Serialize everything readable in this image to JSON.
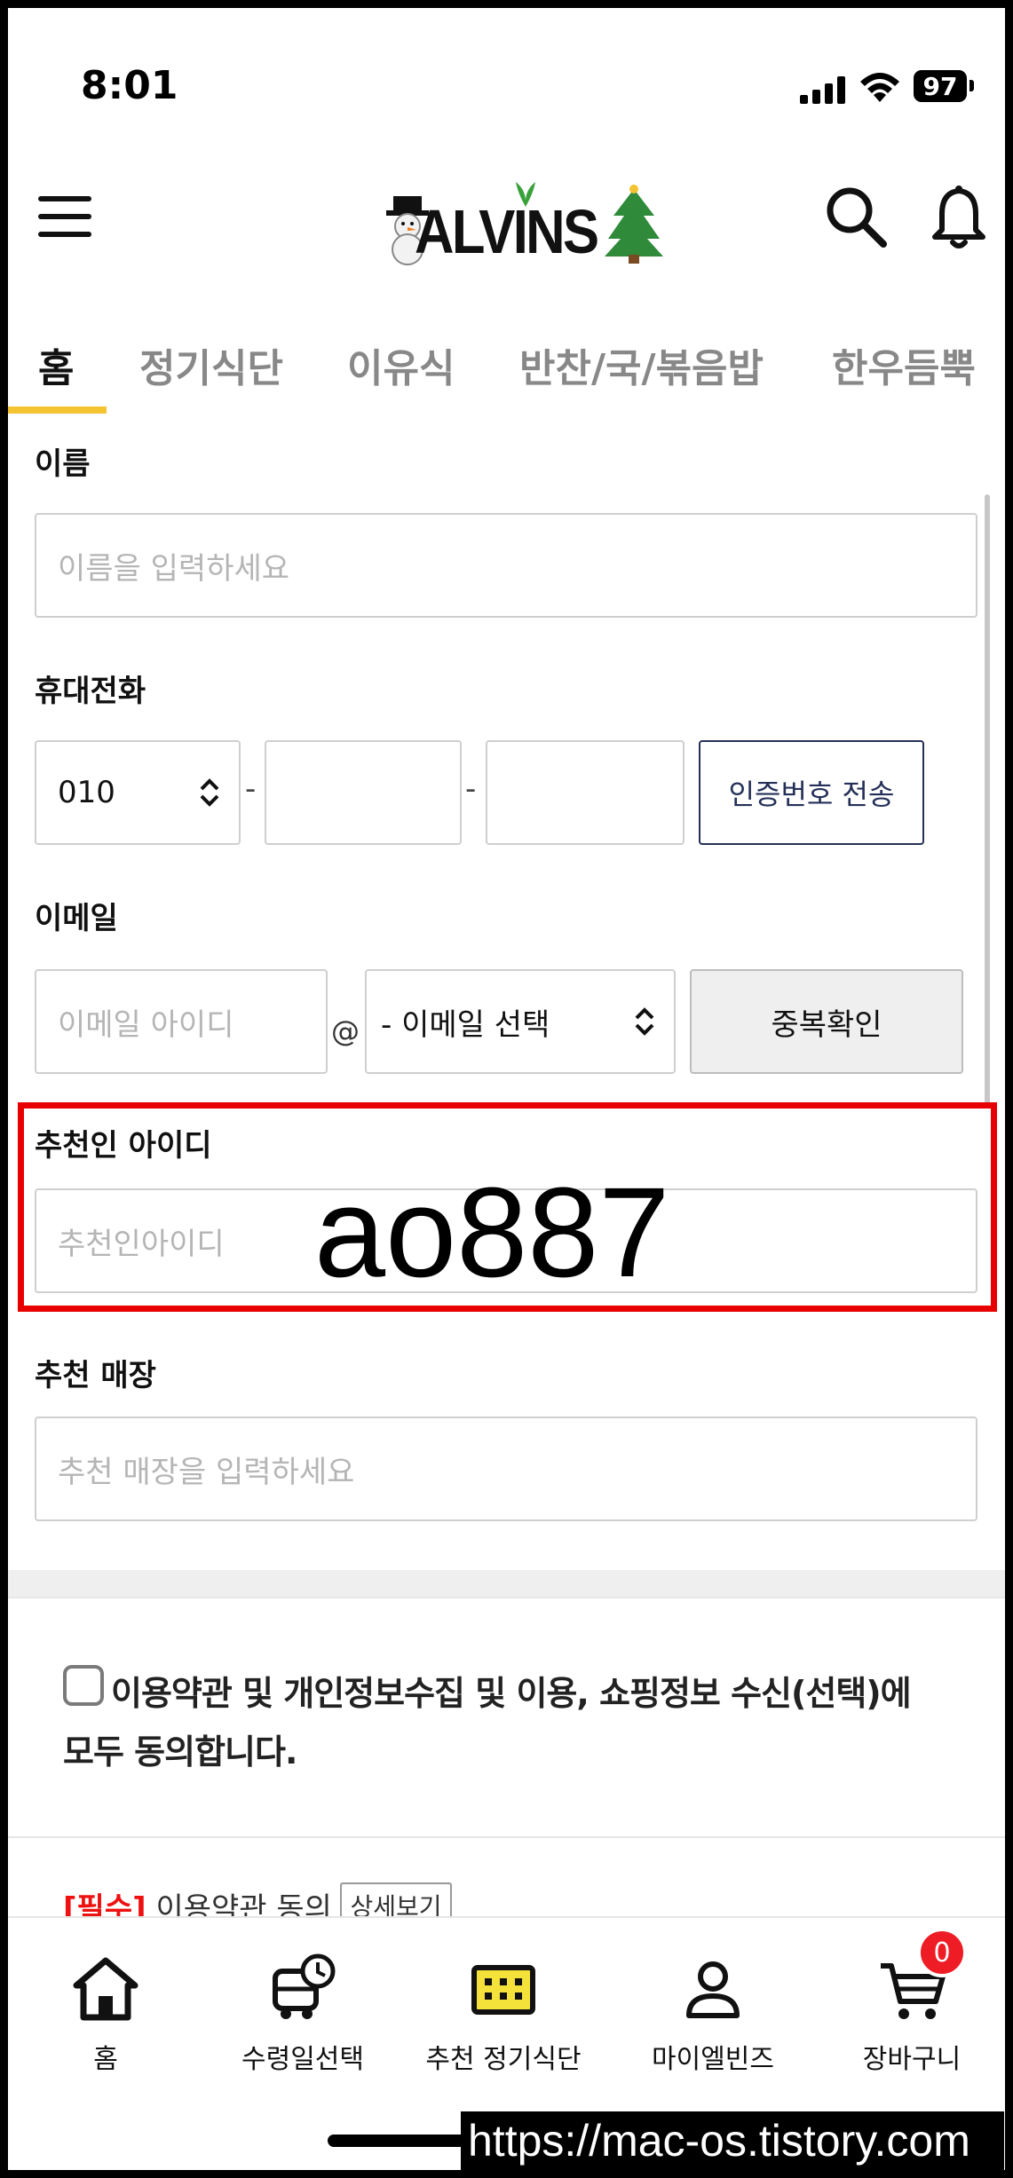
{
  "status_bar": {
    "time": "8:01",
    "battery": "97"
  },
  "header": {
    "logo": "ALVINS",
    "icons": [
      "menu-icon",
      "search-icon",
      "bell-icon"
    ]
  },
  "tabs": [
    {
      "label": "홈",
      "active": true
    },
    {
      "label": "정기식단"
    },
    {
      "label": "이유식"
    },
    {
      "label": "반찬/국/볶음밥"
    },
    {
      "label": "한우듬뿍"
    }
  ],
  "form": {
    "name": {
      "label": "이름",
      "placeholder": "이름을 입력하세요"
    },
    "phone": {
      "label": "휴대전화",
      "prefix": "010",
      "separator": "-",
      "verify_button": "인증번호 전송"
    },
    "email": {
      "label": "이메일",
      "id_placeholder": "이메일 아이디",
      "at": "@",
      "domain_select": "- 이메일 선택",
      "dup_check_button": "중복확인"
    },
    "referrer": {
      "label": "추천인 아이디",
      "placeholder": "추천인아이디",
      "annotation": "ao887"
    },
    "store": {
      "label": "추천 매장",
      "placeholder": "추천 매장을 입력하세요"
    }
  },
  "agreement": {
    "all_agree": "이용약관 및 개인정보수집 및 이용, 쇼핑정보 수신(선택)에 모두 동의합니다.",
    "required_tag": "[필수]",
    "terms_label": "이용약관 동의",
    "detail_button": "상세보기"
  },
  "bottom_nav": [
    {
      "label": "홈",
      "icon": "home-icon"
    },
    {
      "label": "수령일선택",
      "icon": "delivery-truck-clock-icon"
    },
    {
      "label": "추천 정기식단",
      "icon": "calendar-icon"
    },
    {
      "label": "마이엘빈즈",
      "icon": "user-icon"
    },
    {
      "label": "장바구니",
      "icon": "cart-icon",
      "badge": "0"
    }
  ],
  "watermark": "https://mac-os.tistory.com",
  "colors": {
    "accent": "#f4c430",
    "highlight": "#e80000",
    "required": "#e11111",
    "badge": "#ee1c25"
  }
}
